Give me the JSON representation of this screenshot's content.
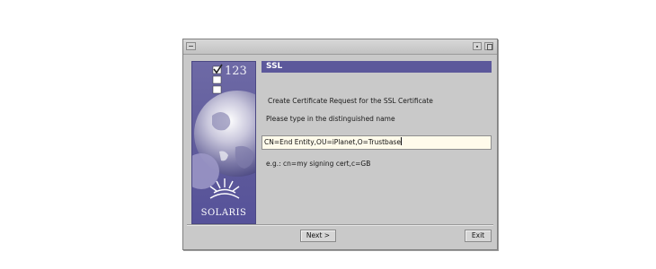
{
  "window": {
    "title_icons": [
      "window-menu-icon",
      "minimize-icon",
      "maximize-icon"
    ]
  },
  "brand": {
    "steps_label": "123",
    "logo_text": "SOLARIS"
  },
  "section": {
    "title": "SSL"
  },
  "content": {
    "heading": "Create Certificate Request for the SSL Certificate",
    "instruction": "Please type in the distinguished name",
    "dn_input_value": "CN=End Entity,OU=iPlanet,O=Trustbase",
    "example": "e.g.: cn=my signing cert,c=GB"
  },
  "buttons": {
    "next": "Next >",
    "exit": "Exit"
  },
  "colors": {
    "header_bar": "#5c589b",
    "panel": "#6e6aa6",
    "window_bg": "#c9c9c9",
    "input_bg": "#fffbeb"
  }
}
